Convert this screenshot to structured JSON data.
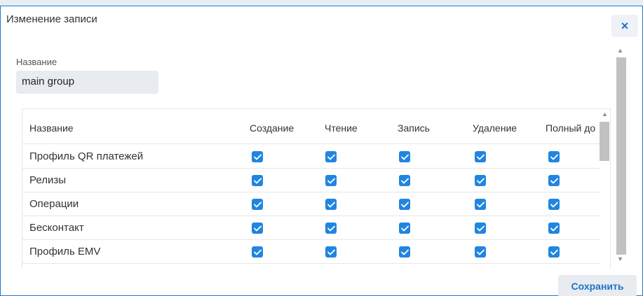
{
  "dialog": {
    "title": "Изменение записи",
    "close_label": "×"
  },
  "form": {
    "name_label": "Название",
    "name_value": "main group"
  },
  "table": {
    "columns": [
      "Название",
      "Создание",
      "Чтение",
      "Запись",
      "Удаление",
      "Полный до"
    ],
    "rows": [
      {
        "name": "Профиль QR платежей",
        "create": true,
        "read": true,
        "write": true,
        "delete": true,
        "full": true
      },
      {
        "name": "Релизы",
        "create": true,
        "read": true,
        "write": true,
        "delete": true,
        "full": true
      },
      {
        "name": "Операции",
        "create": true,
        "read": true,
        "write": true,
        "delete": true,
        "full": true
      },
      {
        "name": "Бесконтакт",
        "create": true,
        "read": true,
        "write": true,
        "delete": true,
        "full": true
      },
      {
        "name": "Профиль EMV",
        "create": true,
        "read": true,
        "write": true,
        "delete": true,
        "full": true
      }
    ]
  },
  "footer": {
    "save_label": "Сохранить"
  },
  "icons": {
    "close": "close-icon",
    "check": "checkmark-icon",
    "scroll_up": "arrow-up-icon",
    "scroll_down": "arrow-down-icon"
  },
  "colors": {
    "accent": "#1e73c8",
    "checkbox": "#2185e0",
    "border": "#1f7ad0"
  }
}
